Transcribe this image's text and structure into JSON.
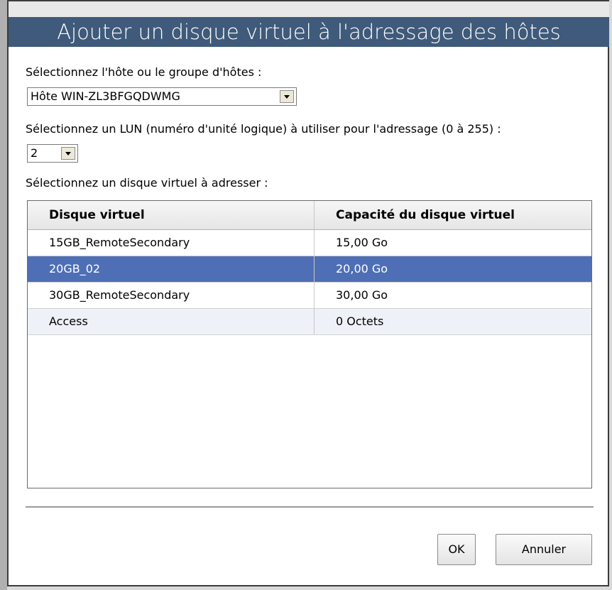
{
  "dialog": {
    "title": "Ajouter un disque virtuel à l'adressage des hôtes"
  },
  "host": {
    "label": "Sélectionnez l'hôte ou le groupe d'hôtes :",
    "selected": "Hôte WIN-ZL3BFGQDWMG"
  },
  "lun": {
    "label": "Sélectionnez un LUN (numéro d'unité logique) à utiliser pour l'adressage (0 à 255) :",
    "selected": "2"
  },
  "disk": {
    "label": "Sélectionnez un disque virtuel à adresser :"
  },
  "table": {
    "columns": [
      "Disque virtuel",
      "Capacité du disque virtuel"
    ],
    "rows": [
      {
        "name": "15GB_RemoteSecondary",
        "capacity": "15,00 Go"
      },
      {
        "name": "20GB_02",
        "capacity": "20,00 Go"
      },
      {
        "name": "30GB_RemoteSecondary",
        "capacity": "30,00 Go"
      },
      {
        "name": "Access",
        "capacity": "0 Octets"
      }
    ],
    "selected_index": 1
  },
  "buttons": {
    "ok": "OK",
    "cancel": "Annuler"
  },
  "colors": {
    "titlebar": "#3f5a7a",
    "selection": "#4e6fb5"
  },
  "icons": {
    "dropdown": "chevron-down-icon"
  }
}
